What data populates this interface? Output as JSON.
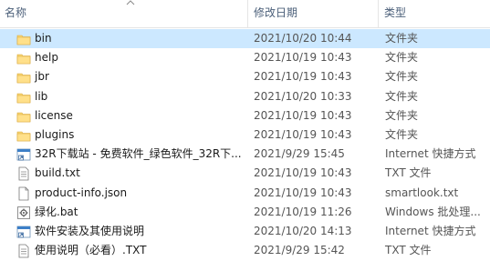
{
  "columns": {
    "name": "名称",
    "date": "修改日期",
    "type": "类型"
  },
  "files": [
    {
      "name": "bin",
      "date": "2021/10/20 10:44",
      "type": "文件夹",
      "icon": "folder-icon",
      "selected": true
    },
    {
      "name": "help",
      "date": "2021/10/19 10:43",
      "type": "文件夹",
      "icon": "folder-icon"
    },
    {
      "name": "jbr",
      "date": "2021/10/19 10:43",
      "type": "文件夹",
      "icon": "folder-icon"
    },
    {
      "name": "lib",
      "date": "2021/10/20 10:33",
      "type": "文件夹",
      "icon": "folder-icon"
    },
    {
      "name": "license",
      "date": "2021/10/19 10:43",
      "type": "文件夹",
      "icon": "folder-icon"
    },
    {
      "name": "plugins",
      "date": "2021/10/19 10:43",
      "type": "文件夹",
      "icon": "folder-icon"
    },
    {
      "name": "32R下载站 - 免费软件_绿色软件_32R下...",
      "date": "2021/9/29 15:45",
      "type": "Internet 快捷方式",
      "icon": "internet-shortcut-icon"
    },
    {
      "name": "build.txt",
      "date": "2021/10/19 10:43",
      "type": "TXT 文件",
      "icon": "text-file-icon"
    },
    {
      "name": "product-info.json",
      "date": "2021/10/19 10:43",
      "type": "smartlook.txt",
      "icon": "blank-file-icon"
    },
    {
      "name": "绿化.bat",
      "date": "2021/10/19 11:26",
      "type": "Windows 批处理...",
      "icon": "batch-file-icon"
    },
    {
      "name": "软件安装及其使用说明",
      "date": "2021/10/20 14:13",
      "type": "Internet 快捷方式",
      "icon": "internet-shortcut-icon"
    },
    {
      "name": "使用说明（必看）.TXT",
      "date": "2021/9/29 15:42",
      "type": "TXT 文件",
      "icon": "text-file-icon"
    }
  ],
  "colors": {
    "selected_row": "#cce8ff",
    "folder": "#f8d775",
    "header_text": "#4c607a"
  }
}
